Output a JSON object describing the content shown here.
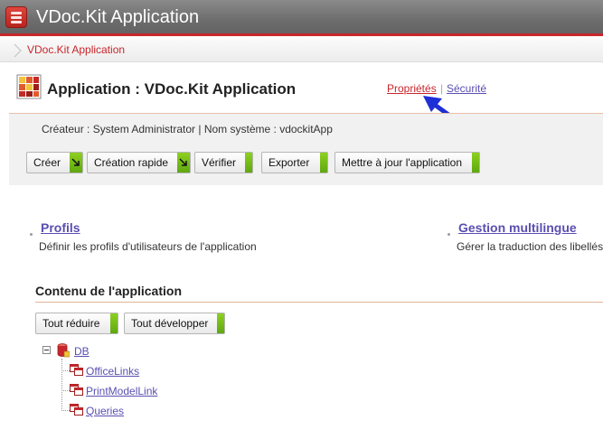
{
  "topbar": {
    "title": "VDoc.Kit Application"
  },
  "breadcrumb": {
    "item": "VDoc.Kit Application"
  },
  "header": {
    "title": "Application : VDoc.Kit Application",
    "links": {
      "properties": "Propriétés",
      "separator": "|",
      "security": "Sécurité"
    }
  },
  "info": {
    "line": "Créateur : System Administrator |  Nom système : vdockitApp"
  },
  "toolbar": {
    "create": "Créer",
    "quick_create": "Création rapide",
    "verify": "Vérifier",
    "export": "Exporter",
    "update": "Mettre à jour l'application"
  },
  "sections": [
    {
      "title": "Profils",
      "description": "Définir les profils d'utilisateurs de l'application"
    },
    {
      "title": "Gestion multilingue",
      "description": "Gérer la traduction des libellés"
    }
  ],
  "content": {
    "title": "Contenu de l'application",
    "collapse_all": "Tout réduire",
    "expand_all": "Tout développer",
    "tree": {
      "root": "DB",
      "children": [
        "OfficeLinks",
        "PrintModelLink",
        "Queries"
      ]
    }
  },
  "colors": {
    "accent_red": "#c8262b",
    "link_purple": "#5a4fb0",
    "button_green": "#7cc11b",
    "annotation_arrow": "#1f2fd6"
  }
}
